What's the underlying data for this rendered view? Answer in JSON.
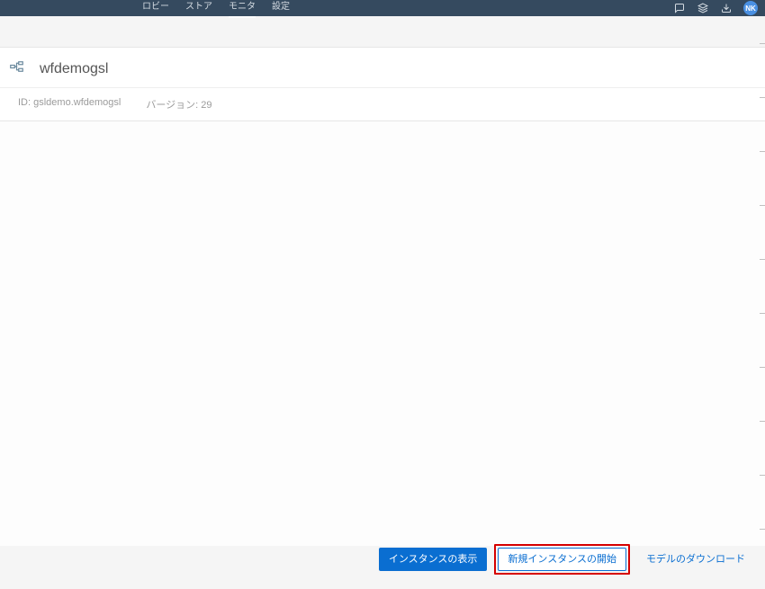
{
  "nav": {
    "items": [
      "ロビー",
      "ストア",
      "モニタ",
      "設定"
    ],
    "activeIndex": 2,
    "avatar": "NK"
  },
  "header": {
    "title": "wfdemogsl"
  },
  "meta": {
    "idLabel": "ID: gsldemo.wfdemogsl",
    "versionLabel": "バージョン: 29"
  },
  "footer": {
    "showInstances": "インスタンスの表示",
    "startNewInstance": "新規インスタンスの開始",
    "downloadModel": "モデルのダウンロード"
  }
}
